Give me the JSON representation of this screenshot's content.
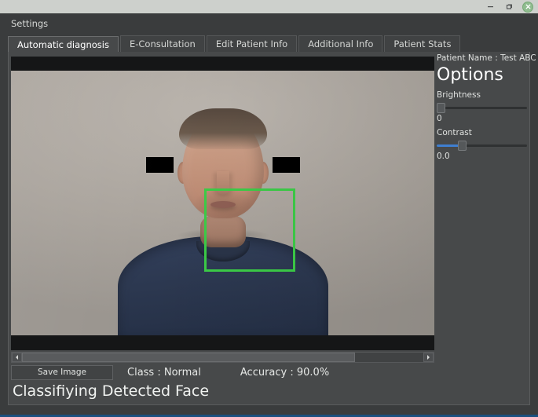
{
  "window": {
    "title_bar": {
      "minimize_icon": "minimize-icon",
      "maximize_icon": "maximize-restore-icon",
      "close_icon": "close-icon",
      "close_color": "#8fbc8f"
    }
  },
  "menu": {
    "items": [
      {
        "label": "Settings"
      }
    ]
  },
  "tabs": [
    {
      "label": "Automatic diagnosis",
      "active": true
    },
    {
      "label": "E-Consultation",
      "active": false
    },
    {
      "label": "Edit Patient Info",
      "active": false
    },
    {
      "label": "Additional Info",
      "active": false
    },
    {
      "label": "Patient Stats",
      "active": false
    }
  ],
  "viewer": {
    "detection_box_color": "#3ccc47",
    "censor_bar_color": "#000000",
    "letterbox_color": "#151617",
    "scrollbar": {
      "left_arrow_icon": "triangle-left-icon",
      "right_arrow_icon": "triangle-right-icon",
      "thumb_fraction": "83%"
    }
  },
  "controls": {
    "save_image_label": "Save Image",
    "class_label": "Class : Normal",
    "accuracy_label": "Accuracy : 90.0%"
  },
  "status": {
    "message": "Classifiying Detected Face"
  },
  "options": {
    "patient_name": "Patient Name : Test ABC",
    "heading": "Options",
    "brightness": {
      "label": "Brightness",
      "value": "0",
      "handle_percent": 0,
      "fill_percent": 0
    },
    "contrast": {
      "label": "Contrast",
      "value": "0.0",
      "handle_percent": 26,
      "fill_percent": 26,
      "fill_color": "#3f7fd0"
    }
  },
  "accent": {
    "bottom_line_color": "#1b4f7e"
  }
}
